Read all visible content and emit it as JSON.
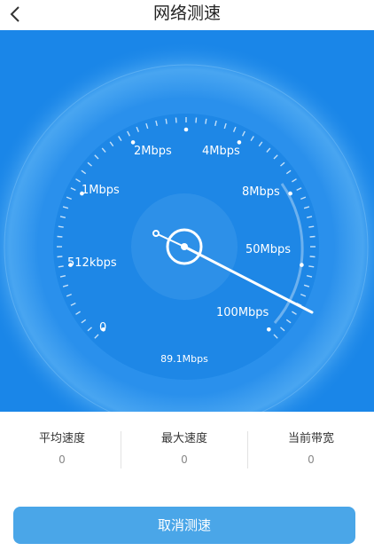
{
  "header": {
    "title": "网络测速",
    "back_icon": "chevron-left-icon"
  },
  "gauge": {
    "ticks": [
      "0",
      "512kbps",
      "1Mbps",
      "2Mbps",
      "4Mbps",
      "8Mbps",
      "50Mbps",
      "100Mbps"
    ],
    "current_speed": "89.1Mbps",
    "needle_level_fraction": 0.97,
    "colors": {
      "background": "#1a86e8",
      "needle": "#ffffff"
    }
  },
  "stats": [
    {
      "label": "平均速度",
      "value": "0"
    },
    {
      "label": "最大速度",
      "value": "0"
    },
    {
      "label": "当前带宽",
      "value": "0"
    }
  ],
  "actions": {
    "cancel_label": "取消测速",
    "cancel_color": "#4aa6e8"
  }
}
